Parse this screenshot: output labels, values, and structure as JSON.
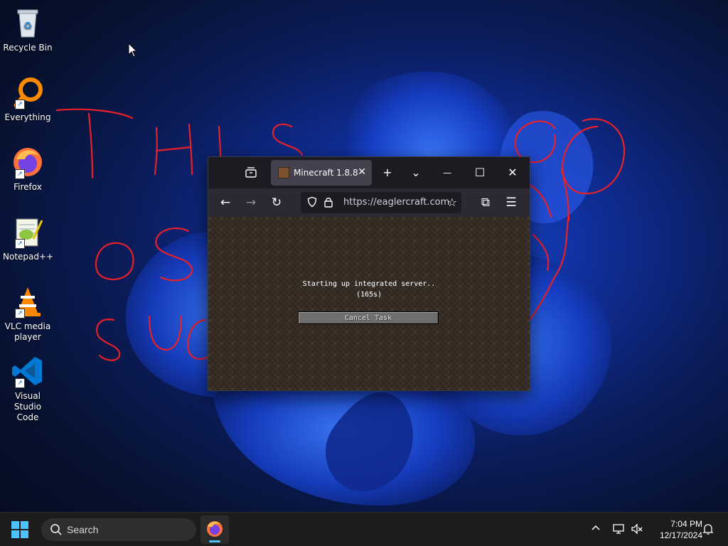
{
  "desktop": {
    "icons": [
      {
        "label": "Recycle Bin",
        "icon": "recycle-bin-icon"
      },
      {
        "label": "Everything",
        "icon": "everything-search-icon"
      },
      {
        "label": "Firefox",
        "icon": "firefox-icon"
      },
      {
        "label": "Notepad++",
        "icon": "notepad-plus-plus-icon"
      },
      {
        "label": "VLC media player",
        "icon": "vlc-icon"
      },
      {
        "label": "Visual Studio Code",
        "icon": "vscode-icon"
      }
    ]
  },
  "browser": {
    "tab": {
      "title": "Minecraft 1.8.8",
      "close_glyph": "✕"
    },
    "new_tab_glyph": "+",
    "list_all_tabs_glyph": "⌄",
    "minimize_glyph": "—",
    "maximize_glyph": "☐",
    "close_glyph": "✕",
    "nav": {
      "back_glyph": "←",
      "forward_glyph": "→",
      "reload_glyph": "↻",
      "url": "https://eaglercraft.com",
      "extensions_glyph": "⧉",
      "menu_glyph": "☰"
    },
    "game": {
      "status": "Starting up integrated server..",
      "elapsed": "(165s)",
      "cancel_label": "Cancel Task"
    }
  },
  "taskbar": {
    "search_label": "Search",
    "time": "7:04 PM",
    "date": "12/17/2024",
    "tray_chevron_glyph": "^"
  },
  "colors": {
    "accent": "#4cc2ff",
    "scribble": "#e8202a",
    "tab_active": "#42414d",
    "taskbar": "#1c1c1c"
  }
}
